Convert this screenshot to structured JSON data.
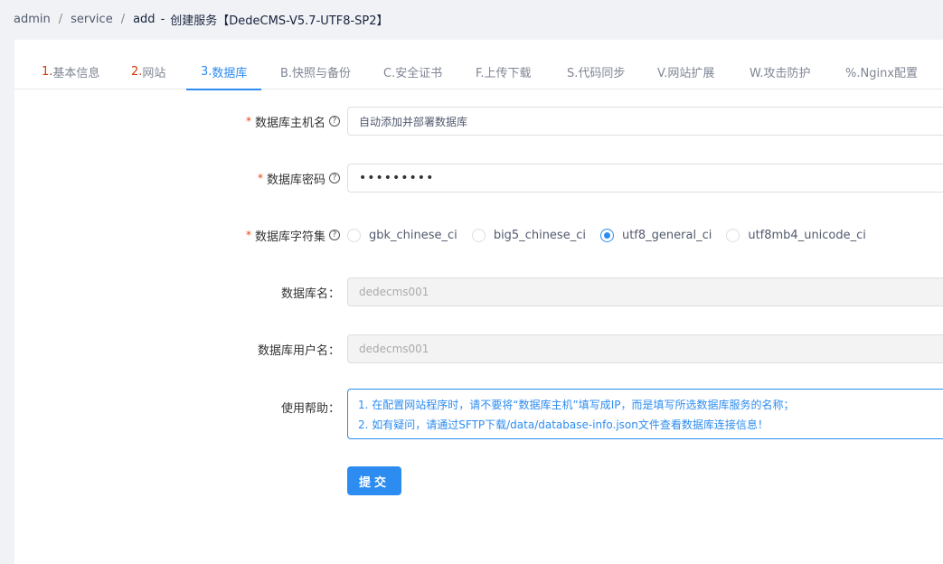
{
  "breadcrumb": {
    "items": [
      "admin",
      "service",
      "add"
    ],
    "dash": "-",
    "title": "创建服务【DedeCMS-V5.7-UTF8-SP2】"
  },
  "tabs": [
    {
      "num": "1.",
      "label": "基本信息"
    },
    {
      "num": "2.",
      "label": "网站"
    },
    {
      "num": "3.",
      "label": "数据库"
    },
    {
      "num": "",
      "label": "B.快照与备份"
    },
    {
      "num": "",
      "label": "C.安全证书"
    },
    {
      "num": "",
      "label": "F.上传下载"
    },
    {
      "num": "",
      "label": "S.代码同步"
    },
    {
      "num": "",
      "label": "V.网站扩展"
    },
    {
      "num": "",
      "label": "W.攻击防护"
    },
    {
      "num": "",
      "label": "%.Nginx配置"
    }
  ],
  "form": {
    "required_mark": "*",
    "help_icon": "?",
    "host": {
      "label": "数据库主机名",
      "value": "自动添加并部署数据库"
    },
    "password": {
      "label": "数据库密码",
      "value": "•••••••••"
    },
    "charset": {
      "label": "数据库字符集",
      "options": [
        "gbk_chinese_ci",
        "big5_chinese_ci",
        "utf8_general_ci",
        "utf8mb4_unicode_ci"
      ],
      "selected": "utf8_general_ci"
    },
    "dbname": {
      "label": "数据库名：",
      "value": "dedecms001"
    },
    "dbuser": {
      "label": "数据库用户名：",
      "value": "dedecms001"
    },
    "help": {
      "label": "使用帮助：",
      "lines": [
        "1. 在配置网站程序时，请不要将“数据库主机”填写成IP，而是填写所选数据库服务的名称；",
        "2. 如有疑问，请通过SFTP下载/data/database-info.json文件查看数据库连接信息！"
      ]
    },
    "submit_label": "提交"
  },
  "colors": {
    "accent": "#2d8cf0",
    "required": "#ed4014",
    "tab_number": "#d4380d"
  }
}
